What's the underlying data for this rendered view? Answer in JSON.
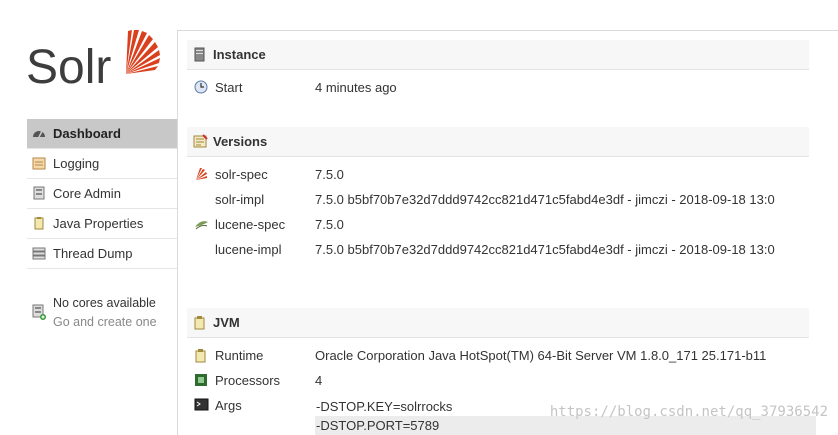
{
  "logo": {
    "text": "Solr"
  },
  "nav": {
    "items": [
      {
        "label": "Dashboard",
        "icon": "dashboard-icon",
        "active": true
      },
      {
        "label": "Logging",
        "icon": "logging-icon"
      },
      {
        "label": "Core Admin",
        "icon": "core-admin-icon"
      },
      {
        "label": "Java Properties",
        "icon": "java-properties-icon"
      },
      {
        "label": "Thread Dump",
        "icon": "thread-dump-icon"
      }
    ]
  },
  "cores": {
    "line1": "No cores available",
    "line2": "Go and create one"
  },
  "instance": {
    "title": "Instance",
    "start_label": "Start",
    "start_value": "4 minutes ago"
  },
  "versions": {
    "title": "Versions",
    "rows": [
      {
        "label": "solr-spec",
        "value": "7.5.0"
      },
      {
        "label": "solr-impl",
        "value": "7.5.0 b5bf70b7e32d7ddd9742cc821d471c5fabd4e3df - jimczi - 2018-09-18 13:0"
      },
      {
        "label": "lucene-spec",
        "value": "7.5.0"
      },
      {
        "label": "lucene-impl",
        "value": "7.5.0 b5bf70b7e32d7ddd9742cc821d471c5fabd4e3df - jimczi - 2018-09-18 13:0"
      }
    ]
  },
  "jvm": {
    "title": "JVM",
    "runtime_label": "Runtime",
    "runtime_value": "Oracle Corporation Java HotSpot(TM) 64-Bit Server VM 1.8.0_171 25.171-b11",
    "processors_label": "Processors",
    "processors_value": "4",
    "args_label": "Args",
    "args": [
      "-DSTOP.KEY=solrrocks",
      "-DSTOP.PORT=5789"
    ]
  },
  "watermark": "https://blog.csdn.net/qq_37936542",
  "colors": {
    "accent": "#d9411e",
    "active_bg": "#c8c8c8"
  }
}
